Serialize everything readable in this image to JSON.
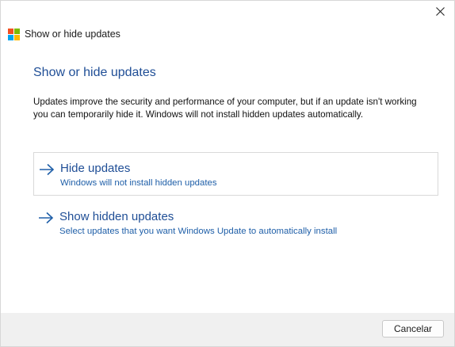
{
  "window": {
    "title": "Show or hide updates",
    "close_icon": "close-icon",
    "app_icon": "windows-logo-icon",
    "app_icon_colors": [
      "#f25022",
      "#7fba00",
      "#00a4ef",
      "#ffb900"
    ]
  },
  "main": {
    "heading": "Show or hide updates",
    "description": "Updates improve the security and performance of your computer, but if an update isn't working you can temporarily hide it. Windows will not install hidden updates automatically.",
    "options": [
      {
        "title": "Hide updates",
        "subtitle": "Windows will not install hidden updates",
        "icon": "arrow-right-icon",
        "selected": true
      },
      {
        "title": "Show hidden updates",
        "subtitle": "Select updates that you want Windows Update to automatically install",
        "icon": "arrow-right-icon",
        "selected": false
      }
    ]
  },
  "footer": {
    "cancel_label": "Cancelar"
  },
  "colors": {
    "link_title": "#1f4e96",
    "link_subtitle": "#1f5fa8",
    "footer_bg": "#f0f0f0"
  }
}
